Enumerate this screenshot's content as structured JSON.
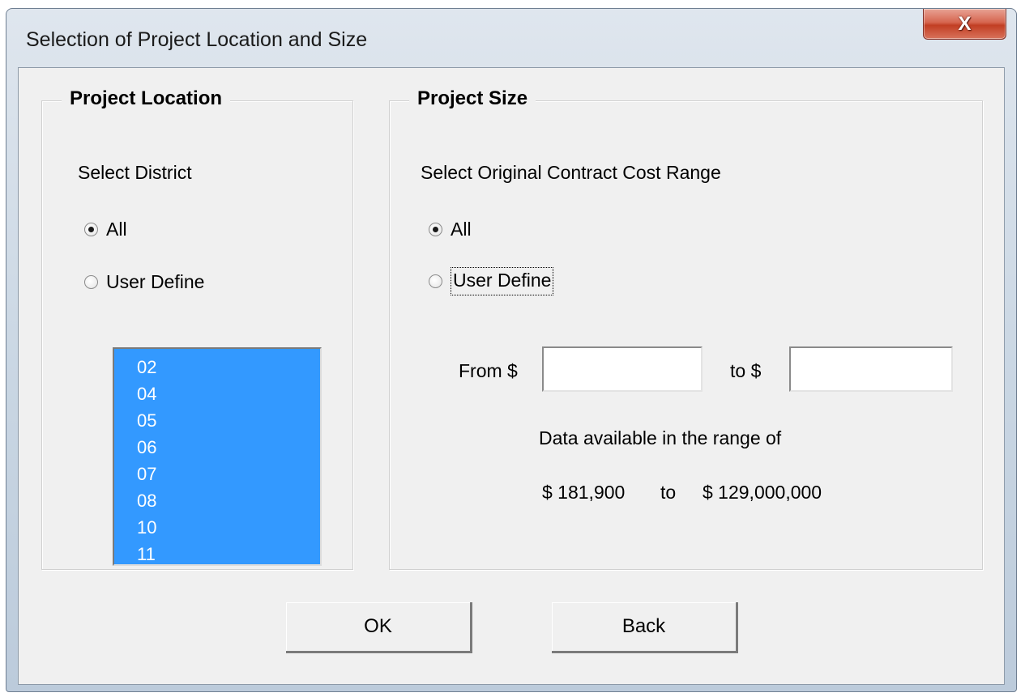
{
  "window": {
    "title": "Selection of Project Location and Size",
    "close_icon": "close-icon",
    "close_glyph": "X"
  },
  "project_location": {
    "group_title": "Project Location",
    "select_label": "Select District",
    "radio_all": "All",
    "radio_user_define": "User Define",
    "selected_option": "All",
    "districts": [
      "02",
      "04",
      "05",
      "06",
      "07",
      "08",
      "10",
      "11"
    ]
  },
  "project_size": {
    "group_title": "Project Size",
    "select_label": "Select Original Contract Cost Range",
    "radio_all": "All",
    "radio_user_define": "User Define",
    "selected_option": "All",
    "from_label": "From $",
    "from_value": "",
    "to_label": "to  $",
    "to_value": "",
    "range_caption": "Data available in the range of",
    "range_min": "$ 181,900",
    "range_separator": "to",
    "range_max": "$ 129,000,000"
  },
  "buttons": {
    "ok": "OK",
    "back": "Back"
  },
  "colors": {
    "selection": "#3399ff",
    "dialog_bg": "#f0f0f0",
    "close_button": "#c23e23"
  }
}
